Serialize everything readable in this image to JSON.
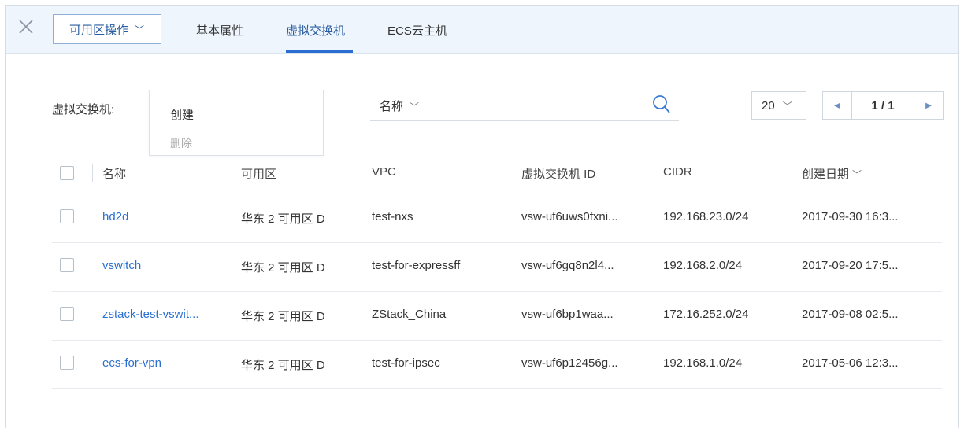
{
  "toolbar": {
    "ops_label": "可用区操作",
    "tabs": [
      {
        "label": "基本属性"
      },
      {
        "label": "虚拟交换机"
      },
      {
        "label": "ECS云主机"
      }
    ]
  },
  "actions": {
    "label": "虚拟交换机:",
    "create": "创建",
    "delete": "删除"
  },
  "search": {
    "field_label": "名称"
  },
  "pagination": {
    "page_size": "20",
    "page_info": "1 / 1"
  },
  "table": {
    "headers": [
      "名称",
      "可用区",
      "VPC",
      "虚拟交换机 ID",
      "CIDR",
      "创建日期"
    ],
    "rows": [
      {
        "name": "hd2d",
        "zone": "华东 2 可用区 D",
        "vpc": "test-nxs",
        "id": "vsw-uf6uws0fxni...",
        "cidr": "192.168.23.0/24",
        "date": "2017-09-30 16:3..."
      },
      {
        "name": "vswitch",
        "zone": "华东 2 可用区 D",
        "vpc": "test-for-expressff",
        "id": "vsw-uf6gq8n2l4...",
        "cidr": "192.168.2.0/24",
        "date": "2017-09-20 17:5..."
      },
      {
        "name": "zstack-test-vswit...",
        "zone": "华东 2 可用区 D",
        "vpc": "ZStack_China",
        "id": "vsw-uf6bp1waa...",
        "cidr": "172.16.252.0/24",
        "date": "2017-09-08 02:5..."
      },
      {
        "name": "ecs-for-vpn",
        "zone": "华东 2 可用区 D",
        "vpc": "test-for-ipsec",
        "id": "vsw-uf6p12456g...",
        "cidr": "192.168.1.0/24",
        "date": "2017-05-06 12:3..."
      }
    ]
  },
  "colors": {
    "accent": "#2a6fd1",
    "topbar_bg": "#eef5fd"
  }
}
